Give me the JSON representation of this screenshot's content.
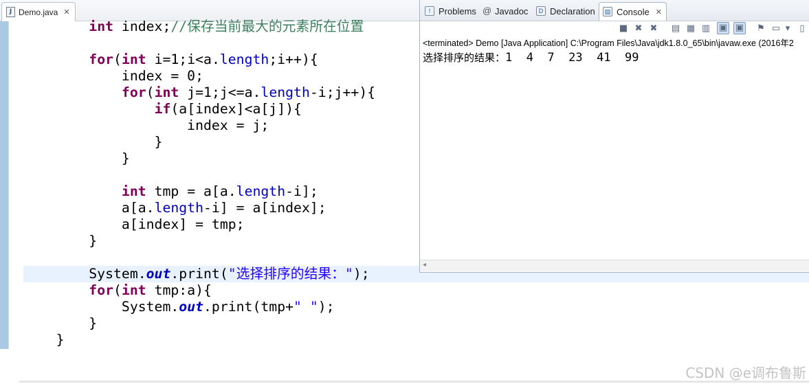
{
  "editor": {
    "tab_label": "Demo.java",
    "tab_close": "✕",
    "file_icon_letter": "J",
    "code_lines": [
      [
        {
          "t": "        "
        },
        {
          "t": "int",
          "c": "kw"
        },
        {
          "t": " index;"
        },
        {
          "t": "//保存当前最大的元素所在位置",
          "c": "cmt"
        }
      ],
      [
        {
          "t": ""
        }
      ],
      [
        {
          "t": "        "
        },
        {
          "t": "for",
          "c": "kw"
        },
        {
          "t": "("
        },
        {
          "t": "int",
          "c": "kw"
        },
        {
          "t": " i=1;i<a."
        },
        {
          "t": "length",
          "c": "fld"
        },
        {
          "t": ";i++){"
        }
      ],
      [
        {
          "t": "            index = 0;"
        }
      ],
      [
        {
          "t": "            "
        },
        {
          "t": "for",
          "c": "kw"
        },
        {
          "t": "("
        },
        {
          "t": "int",
          "c": "kw"
        },
        {
          "t": " j=1;j<=a."
        },
        {
          "t": "length",
          "c": "fld"
        },
        {
          "t": "-i;j++){"
        }
      ],
      [
        {
          "t": "                "
        },
        {
          "t": "if",
          "c": "kw"
        },
        {
          "t": "(a[index]<a[j]){"
        }
      ],
      [
        {
          "t": "                    index = j;"
        }
      ],
      [
        {
          "t": "                }"
        }
      ],
      [
        {
          "t": "            }"
        }
      ],
      [
        {
          "t": ""
        }
      ],
      [
        {
          "t": "            "
        },
        {
          "t": "int",
          "c": "kw"
        },
        {
          "t": " tmp = a[a."
        },
        {
          "t": "length",
          "c": "fld"
        },
        {
          "t": "-i];"
        }
      ],
      [
        {
          "t": "            a[a."
        },
        {
          "t": "length",
          "c": "fld"
        },
        {
          "t": "-i] = a[index];"
        }
      ],
      [
        {
          "t": "            a[index] = tmp;"
        }
      ],
      [
        {
          "t": "        }"
        }
      ],
      [
        {
          "t": ""
        }
      ],
      [
        {
          "t": "        System."
        },
        {
          "t": "out",
          "c": "stat"
        },
        {
          "t": ".print("
        },
        {
          "t": "\"选择排序的结果：\"",
          "c": "str"
        },
        {
          "t": ");"
        }
      ],
      [
        {
          "t": "        "
        },
        {
          "t": "for",
          "c": "kw"
        },
        {
          "t": "("
        },
        {
          "t": "int",
          "c": "kw"
        },
        {
          "t": " tmp:a){"
        }
      ],
      [
        {
          "t": "            System."
        },
        {
          "t": "out",
          "c": "stat"
        },
        {
          "t": ".print(tmp+"
        },
        {
          "t": "\" \"",
          "c": "str"
        },
        {
          "t": ");"
        }
      ],
      [
        {
          "t": "        }"
        }
      ],
      [
        {
          "t": "    }"
        }
      ],
      [
        {
          "t": "}"
        }
      ]
    ]
  },
  "console_view": {
    "tabs": [
      {
        "label": "Problems",
        "icon": "problems-icon",
        "glyph": "!"
      },
      {
        "label": "Javadoc",
        "icon": "javadoc-icon",
        "glyph": "@"
      },
      {
        "label": "Declaration",
        "icon": "declaration-icon",
        "glyph": "D"
      },
      {
        "label": "Console",
        "icon": "console-icon",
        "glyph": "▤",
        "active": true,
        "close": "✕"
      }
    ],
    "status_line": "<terminated> Demo [Java Application] C:\\Program Files\\Java\\jdk1.8.0_65\\bin\\javaw.exe (2016年2",
    "output_label": "选择排序的结果：",
    "output_values": "1  4  7  23  41  99"
  },
  "watermark": "CSDN @e调布鲁斯"
}
